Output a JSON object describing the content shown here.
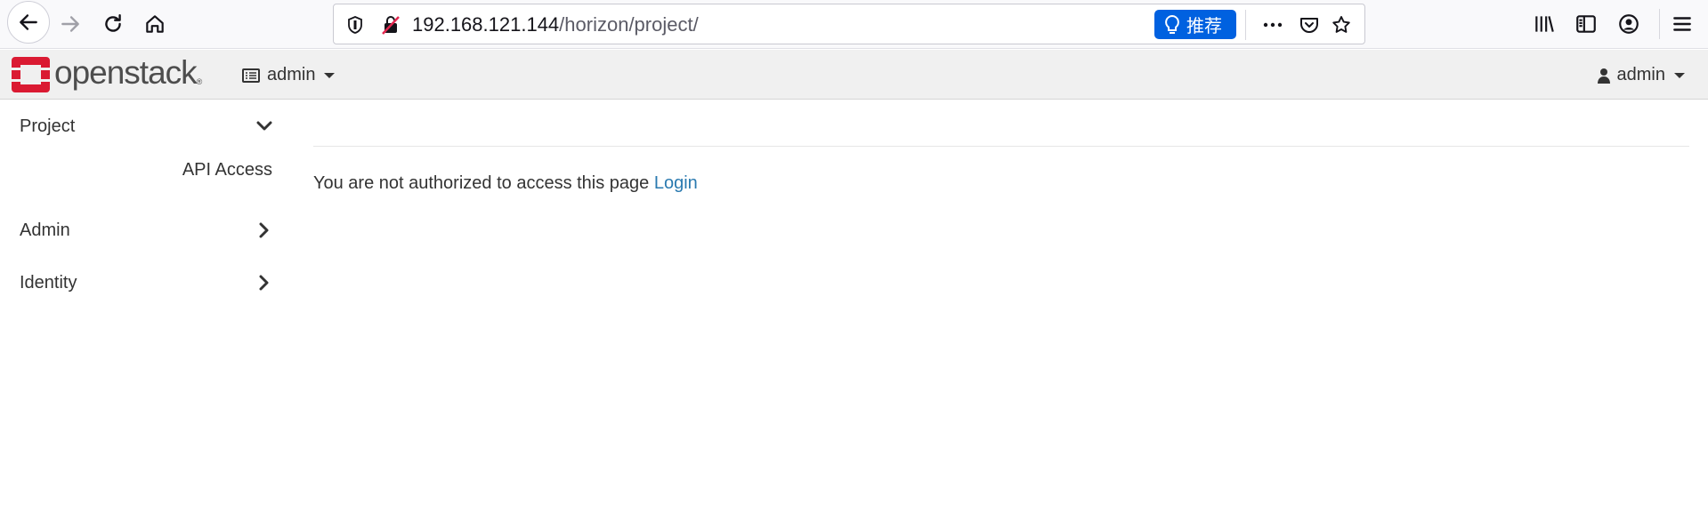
{
  "browser": {
    "url_host": "192.168.121.144",
    "url_path": "/horizon/project/",
    "recommend_label": "推荐",
    "icons": [
      "back-icon",
      "forward-icon",
      "reload-icon",
      "home-icon",
      "tracking-shield-icon",
      "insecure-lock-icon",
      "lightbulb-icon",
      "more-icon",
      "pocket-icon",
      "star-icon",
      "library-icon",
      "sidebar-icon",
      "account-icon",
      "hamburger-menu-icon"
    ]
  },
  "header": {
    "logo_text": "openstack",
    "logo_reg": "®",
    "project_label": "admin",
    "user_label": "admin",
    "brand_color": "#da1a32"
  },
  "sidebar": {
    "items": [
      {
        "label": "Project",
        "state": "expanded"
      },
      {
        "label": "Admin",
        "state": "collapsed"
      },
      {
        "label": "Identity",
        "state": "collapsed"
      }
    ],
    "project_subitems": [
      {
        "label": "API Access"
      }
    ]
  },
  "main": {
    "message": "You are not authorized to access this page",
    "login_link": "Login",
    "link_color": "#2a7ab0"
  }
}
